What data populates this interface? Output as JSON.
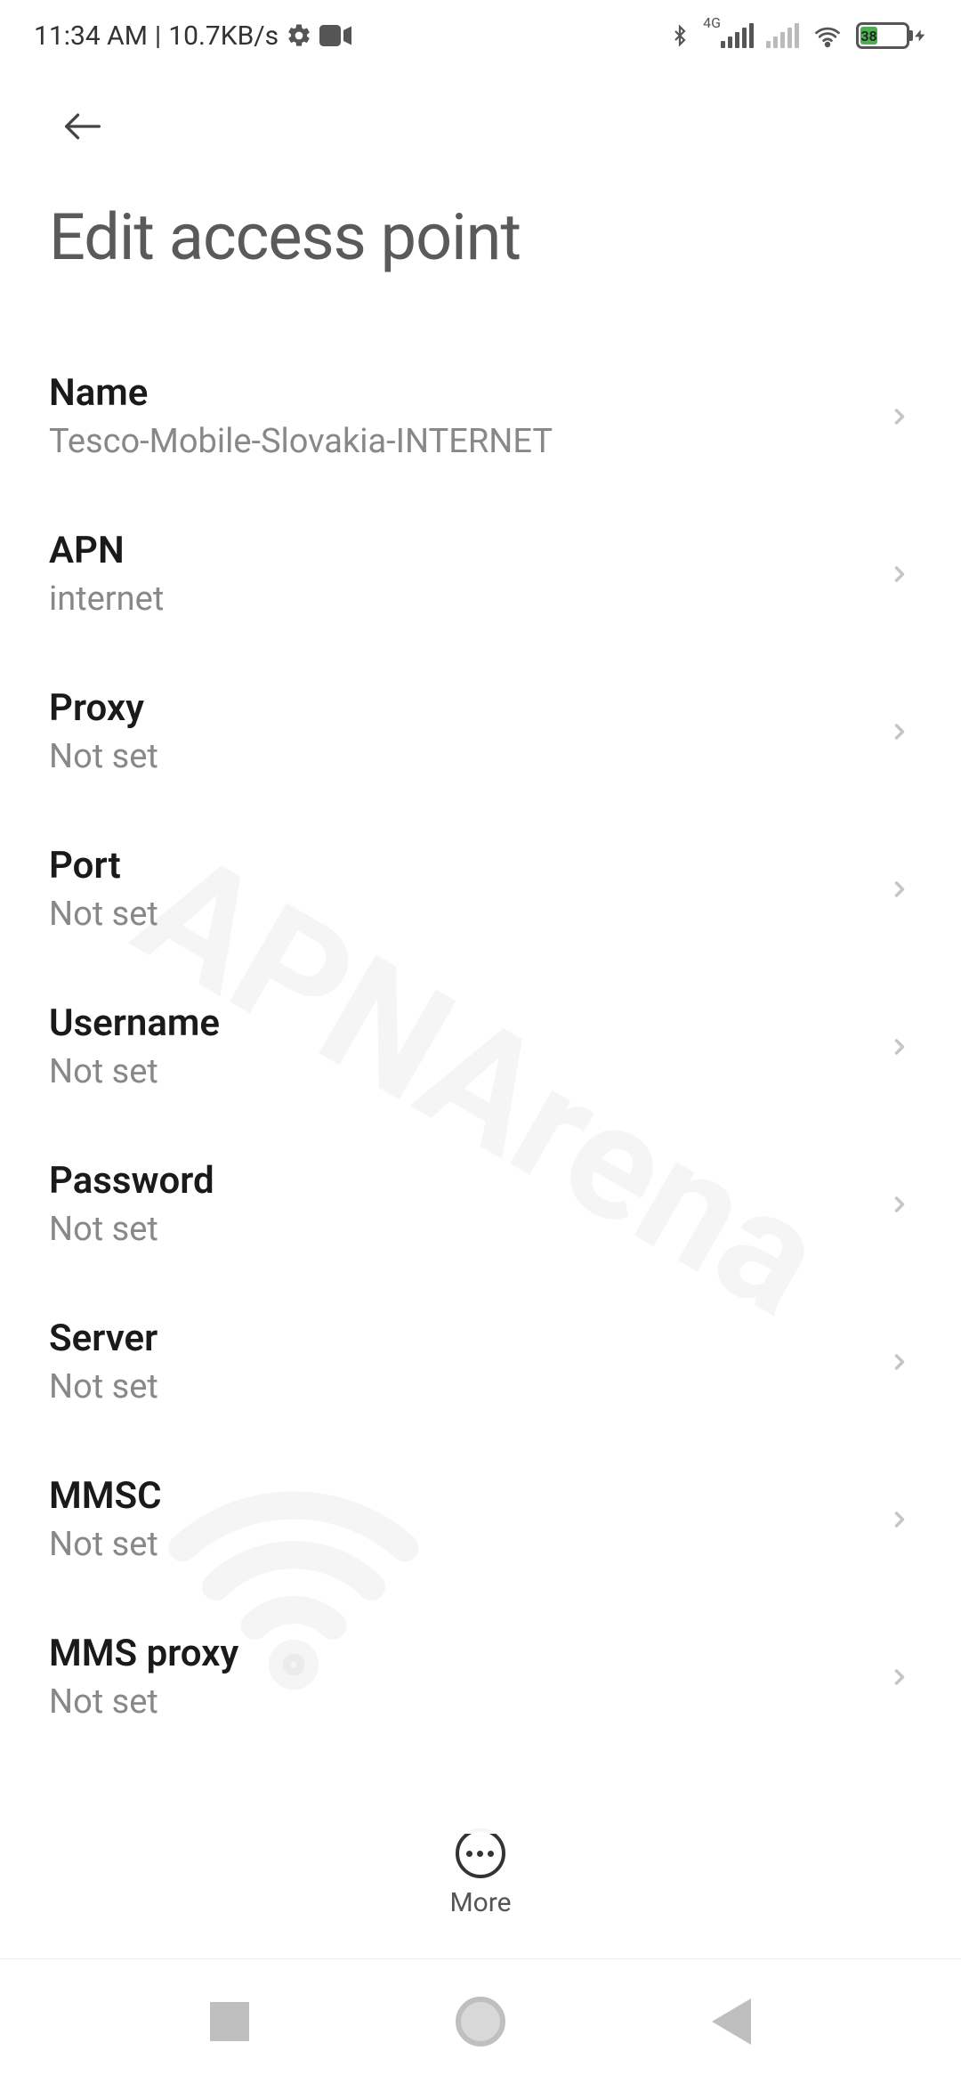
{
  "status_bar": {
    "time": "11:34 AM",
    "separator": "|",
    "data_rate": "10.7KB/s",
    "network_type": "4G",
    "battery_percent": "38"
  },
  "page_title": "Edit access point",
  "rows": [
    {
      "label": "Name",
      "value": "Tesco-Mobile-Slovakia-INTERNET"
    },
    {
      "label": "APN",
      "value": "internet"
    },
    {
      "label": "Proxy",
      "value": "Not set"
    },
    {
      "label": "Port",
      "value": "Not set"
    },
    {
      "label": "Username",
      "value": "Not set"
    },
    {
      "label": "Password",
      "value": "Not set"
    },
    {
      "label": "Server",
      "value": "Not set"
    },
    {
      "label": "MMSC",
      "value": "Not set"
    },
    {
      "label": "MMS proxy",
      "value": "Not set"
    }
  ],
  "toolbar": {
    "more_label": "More"
  },
  "watermark_text": "APNArena"
}
